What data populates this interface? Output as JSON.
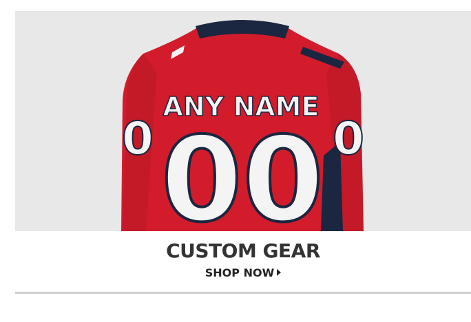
{
  "banner": {
    "image_alt": "Customizable hockey jersey, back view",
    "jersey_name": "ANY NAME",
    "jersey_number": "00",
    "sleeve_number_left": "0",
    "sleeve_number_right": "0",
    "colors": {
      "background": "#e8e8e8",
      "jersey_red": "#d21c2b",
      "navy": "#1b2640",
      "white": "#f4f4f4"
    }
  },
  "promo": {
    "headline": "CUSTOM GEAR",
    "cta_label": "SHOP NOW"
  }
}
